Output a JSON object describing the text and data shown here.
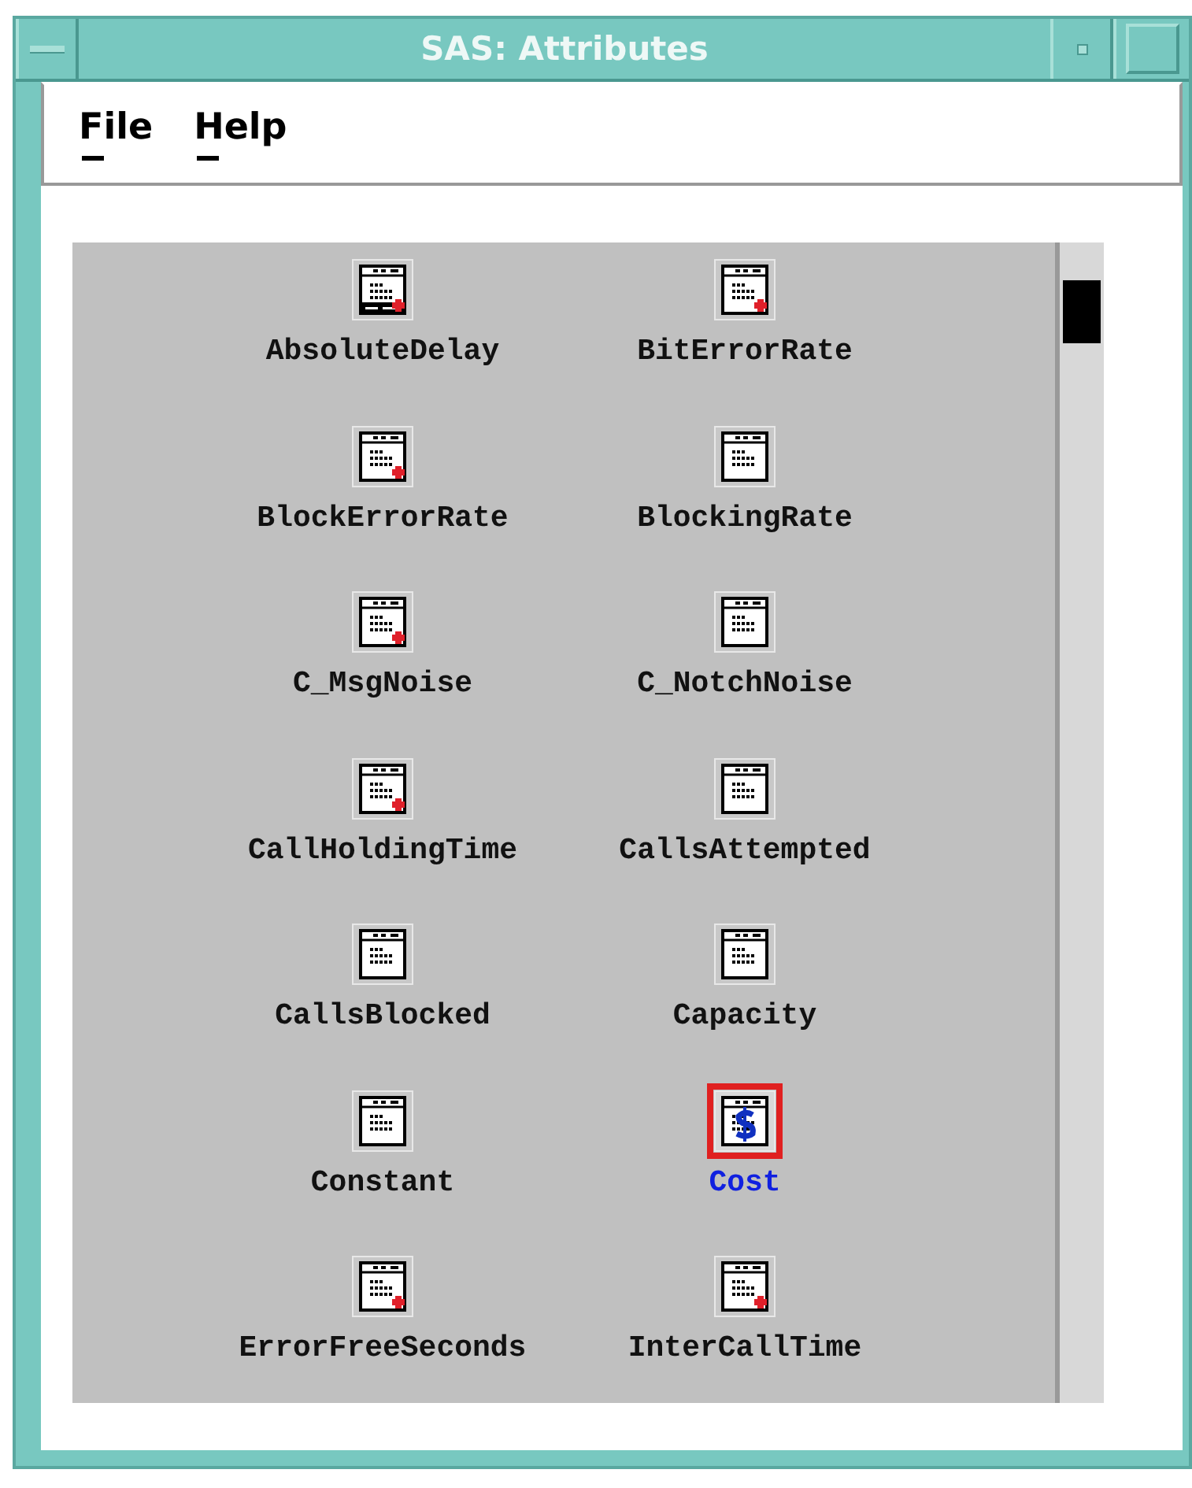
{
  "window": {
    "title": "SAS: Attributes"
  },
  "menu": [
    {
      "label": "File"
    },
    {
      "label": "Help"
    }
  ],
  "items": [
    {
      "label": "AbsoluteDelay",
      "kind": "delay",
      "flagged": true,
      "selected": false
    },
    {
      "label": "BitErrorRate",
      "kind": "table",
      "flagged": true,
      "selected": false
    },
    {
      "label": "BlockErrorRate",
      "kind": "table",
      "flagged": true,
      "selected": false
    },
    {
      "label": "BlockingRate",
      "kind": "table",
      "flagged": false,
      "selected": false
    },
    {
      "label": "C_MsgNoise",
      "kind": "table",
      "flagged": true,
      "selected": false
    },
    {
      "label": "C_NotchNoise",
      "kind": "table",
      "flagged": false,
      "selected": false
    },
    {
      "label": "CallHoldingTime",
      "kind": "table",
      "flagged": true,
      "selected": false
    },
    {
      "label": "CallsAttempted",
      "kind": "table",
      "flagged": false,
      "selected": false
    },
    {
      "label": "CallsBlocked",
      "kind": "table",
      "flagged": false,
      "selected": false
    },
    {
      "label": "Capacity",
      "kind": "table",
      "flagged": false,
      "selected": false
    },
    {
      "label": "Constant",
      "kind": "table",
      "flagged": false,
      "selected": false
    },
    {
      "label": "Cost",
      "kind": "cost",
      "flagged": false,
      "selected": true
    },
    {
      "label": "ErrorFreeSeconds",
      "kind": "table",
      "flagged": true,
      "selected": false
    },
    {
      "label": "InterCallTime",
      "kind": "table",
      "flagged": true,
      "selected": false
    }
  ]
}
